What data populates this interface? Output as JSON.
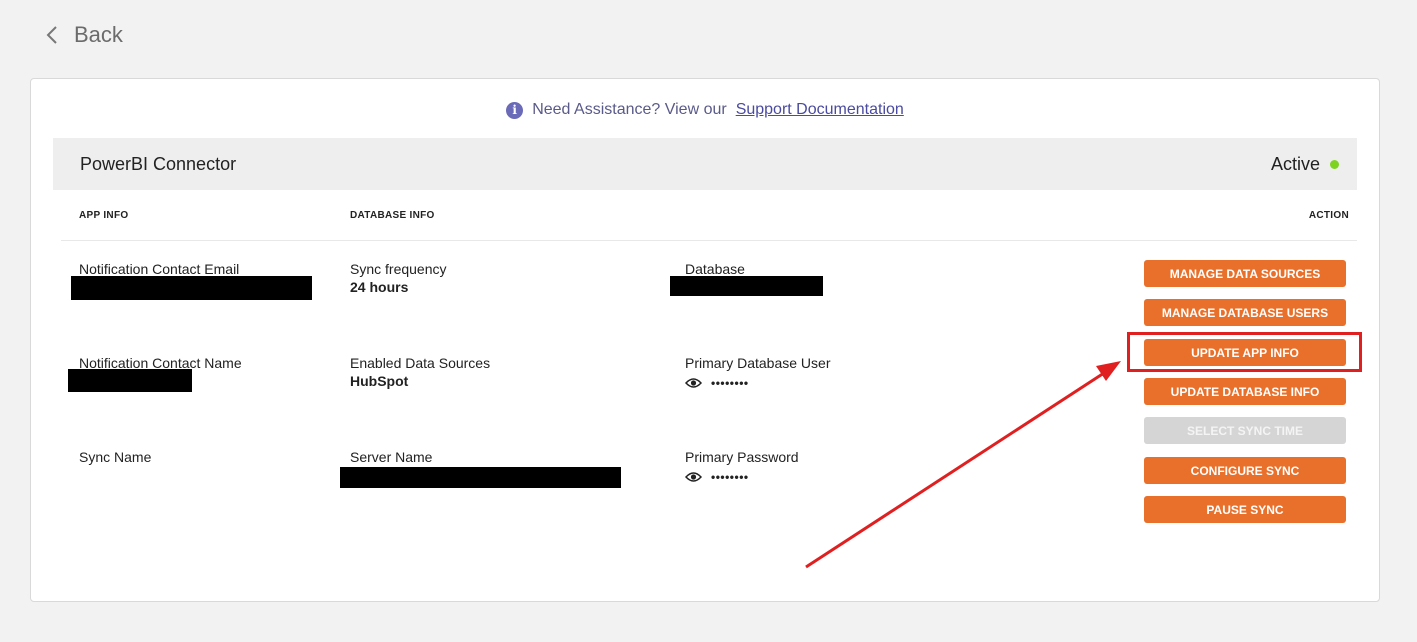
{
  "nav": {
    "back_label": "Back"
  },
  "assist": {
    "prefix": "Need Assistance? View our",
    "link": "Support Documentation"
  },
  "connector": {
    "name": "PowerBI Connector",
    "status": "Active",
    "status_color": "#7ed321"
  },
  "columns": {
    "app_info": "APP INFO",
    "database_info": "DATABASE INFO",
    "action": "ACTION"
  },
  "app_info": {
    "email_label": "Notification Contact Email",
    "name_label": "Notification Contact Name",
    "sync_name_label": "Sync Name"
  },
  "database_info": {
    "sync_frequency_label": "Sync frequency",
    "sync_frequency_value": "24 hours",
    "enabled_sources_label": "Enabled Data Sources",
    "enabled_sources_value": "HubSpot",
    "server_name_label": "Server Name"
  },
  "database_details": {
    "database_label": "Database",
    "primary_user_label": "Primary Database User",
    "primary_user_value": "••••••••",
    "primary_password_label": "Primary Password",
    "primary_password_value": "••••••••"
  },
  "actions": [
    {
      "label": "MANAGE DATA SOURCES",
      "enabled": true
    },
    {
      "label": "MANAGE DATABASE USERS",
      "enabled": true
    },
    {
      "label": "UPDATE APP INFO",
      "enabled": true
    },
    {
      "label": "UPDATE DATABASE INFO",
      "enabled": true
    },
    {
      "label": "SELECT SYNC TIME",
      "enabled": false
    },
    {
      "label": "CONFIGURE SYNC",
      "enabled": true
    },
    {
      "label": "PAUSE SYNC",
      "enabled": true
    }
  ],
  "colors": {
    "accent": "#e8702b",
    "disabled": "#d5d5d5",
    "annotation": "#e02020"
  },
  "icons": {
    "back": "chevron-left-icon",
    "info": "info-icon",
    "reveal": "eye-icon"
  }
}
